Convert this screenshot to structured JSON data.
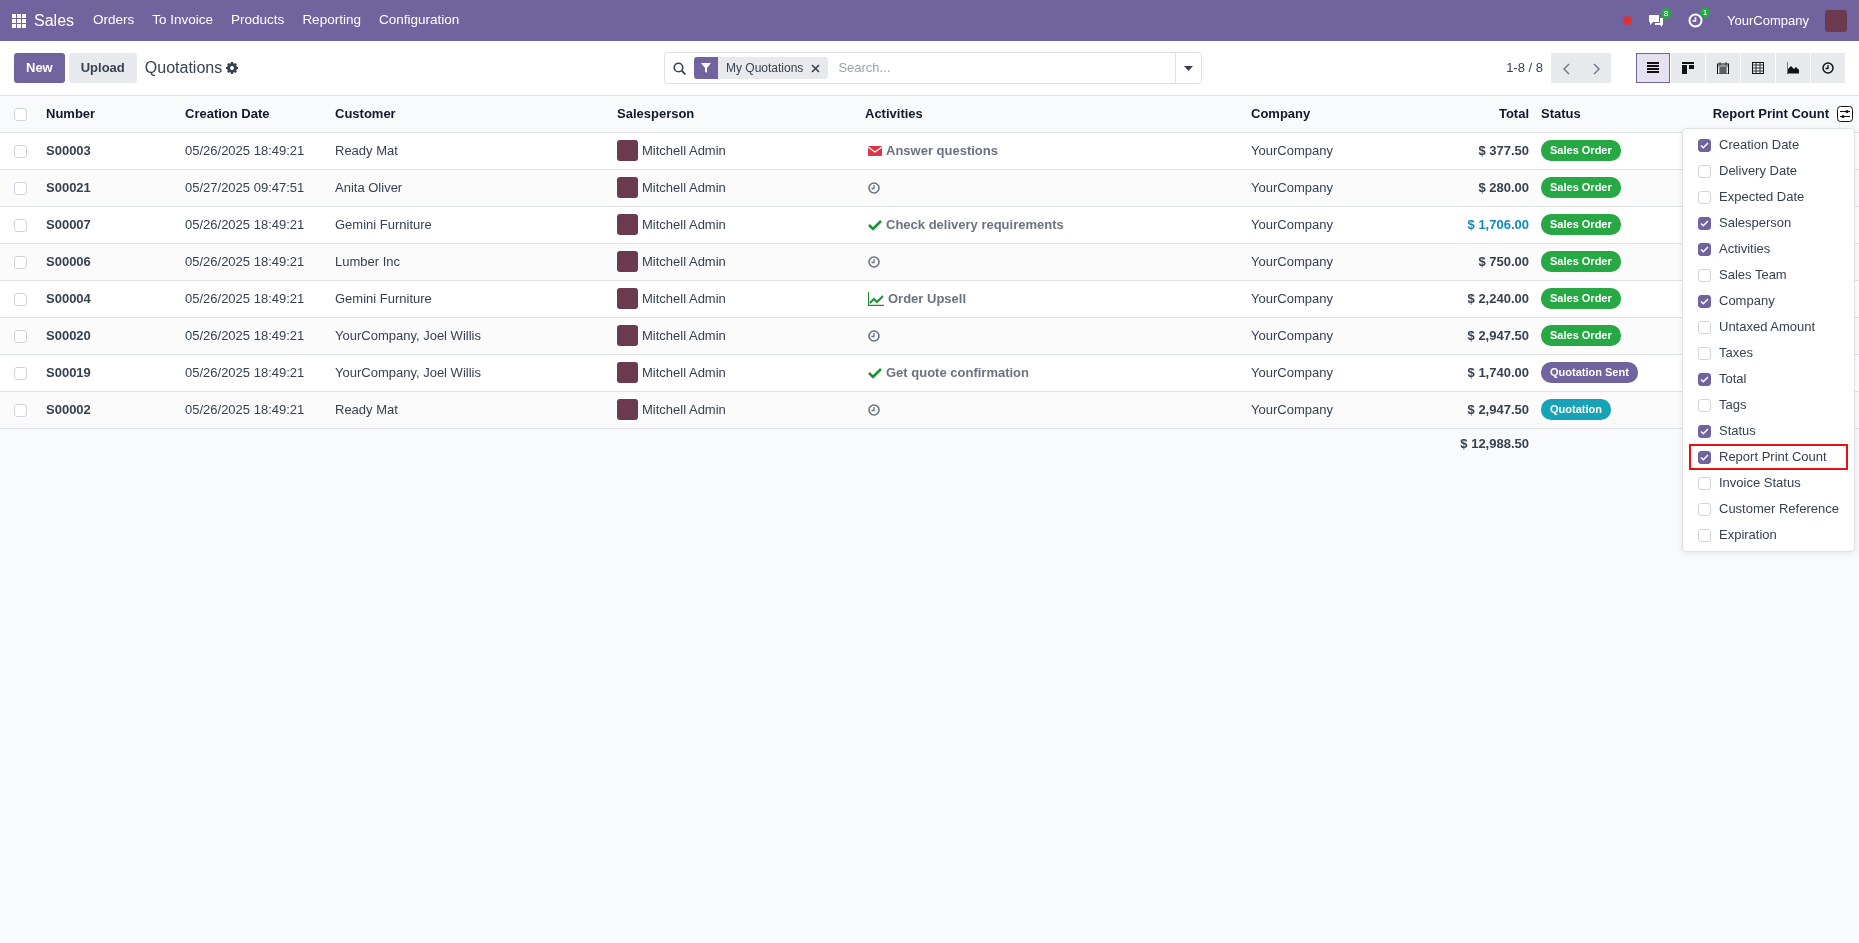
{
  "navbar": {
    "app": "Sales",
    "menu": [
      "Orders",
      "To Invoice",
      "Products",
      "Reporting",
      "Configuration"
    ],
    "messages_count": "8",
    "activities_count": "1",
    "company": "YourCompany"
  },
  "control_panel": {
    "buttons": [
      {
        "label": "New",
        "kind": "primary"
      },
      {
        "label": "Upload",
        "kind": "secondary"
      }
    ],
    "breadcrumb": "Quotations",
    "filter_facet": "My Quotations",
    "search_placeholder": "Search...",
    "pager": "1-8 / 8",
    "views": [
      {
        "kind": "list",
        "selected": true
      },
      {
        "kind": "kanban",
        "selected": false
      },
      {
        "kind": "calendar",
        "selected": false
      },
      {
        "kind": "pivot",
        "selected": false
      },
      {
        "kind": "graph",
        "selected": false
      },
      {
        "kind": "activity",
        "selected": false
      }
    ]
  },
  "table": {
    "all_selected": false,
    "columns": [
      "Number",
      "Creation Date",
      "Customer",
      "Salesperson",
      "Activities",
      "Company",
      "Total",
      "Status",
      "Report Print Count"
    ],
    "rows": [
      {
        "selected": false,
        "number": "S00003",
        "creation_date": "05/26/2025 18:49:21",
        "customer": "Ready Mat",
        "salesperson": "Mitchell Admin",
        "activity": {
          "kind": "email",
          "label": "Answer questions"
        },
        "company": "YourCompany",
        "total": "$ 377.50",
        "total_highlighted": false,
        "status": {
          "label": "Sales Order",
          "color": "#28a745"
        }
      },
      {
        "selected": false,
        "number": "S00021",
        "creation_date": "05/27/2025 09:47:51",
        "customer": "Anita Oliver",
        "salesperson": "Mitchell Admin",
        "activity": {
          "kind": "clock"
        },
        "company": "YourCompany",
        "total": "$ 280.00",
        "total_highlighted": false,
        "status": {
          "label": "Sales Order",
          "color": "#28a745"
        }
      },
      {
        "selected": false,
        "number": "S00007",
        "creation_date": "05/26/2025 18:49:21",
        "customer": "Gemini Furniture",
        "salesperson": "Mitchell Admin",
        "activity": {
          "kind": "check",
          "label": "Check delivery requirements"
        },
        "company": "YourCompany",
        "total": "$ 1,706.00",
        "total_highlighted": true,
        "status": {
          "label": "Sales Order",
          "color": "#28a745"
        }
      },
      {
        "selected": false,
        "number": "S00006",
        "creation_date": "05/26/2025 18:49:21",
        "customer": "Lumber Inc",
        "salesperson": "Mitchell Admin",
        "activity": {
          "kind": "clock"
        },
        "company": "YourCompany",
        "total": "$ 750.00",
        "total_highlighted": false,
        "status": {
          "label": "Sales Order",
          "color": "#28a745"
        }
      },
      {
        "selected": false,
        "number": "S00004",
        "creation_date": "05/26/2025 18:49:21",
        "customer": "Gemini Furniture",
        "salesperson": "Mitchell Admin",
        "activity": {
          "kind": "upsell",
          "label": "Order Upsell"
        },
        "company": "YourCompany",
        "total": "$ 2,240.00",
        "total_highlighted": false,
        "status": {
          "label": "Sales Order",
          "color": "#28a745"
        }
      },
      {
        "selected": false,
        "number": "S00020",
        "creation_date": "05/26/2025 18:49:21",
        "customer": "YourCompany, Joel Willis",
        "salesperson": "Mitchell Admin",
        "activity": {
          "kind": "clock"
        },
        "company": "YourCompany",
        "total": "$ 2,947.50",
        "total_highlighted": false,
        "status": {
          "label": "Sales Order",
          "color": "#28a745"
        }
      },
      {
        "selected": false,
        "number": "S00019",
        "creation_date": "05/26/2025 18:49:21",
        "customer": "YourCompany, Joel Willis",
        "salesperson": "Mitchell Admin",
        "activity": {
          "kind": "check",
          "label": "Get quote confirmation"
        },
        "company": "YourCompany",
        "total": "$ 1,740.00",
        "total_highlighted": false,
        "status": {
          "label": "Quotation Sent",
          "color": "#71639e"
        }
      },
      {
        "selected": false,
        "number": "S00002",
        "creation_date": "05/26/2025 18:49:21",
        "customer": "Ready Mat",
        "salesperson": "Mitchell Admin",
        "activity": {
          "kind": "clock"
        },
        "company": "YourCompany",
        "total": "$ 2,947.50",
        "total_highlighted": false,
        "status": {
          "label": "Quotation",
          "color": "#17a2b8"
        }
      }
    ],
    "footer_total": "$ 12,988.50"
  },
  "column_menu": {
    "items": [
      {
        "label": "Creation Date",
        "checked": true,
        "highlighted": false
      },
      {
        "label": "Delivery Date",
        "checked": false,
        "highlighted": false
      },
      {
        "label": "Expected Date",
        "checked": false,
        "highlighted": false
      },
      {
        "label": "Salesperson",
        "checked": true,
        "highlighted": false
      },
      {
        "label": "Activities",
        "checked": true,
        "highlighted": false
      },
      {
        "label": "Sales Team",
        "checked": false,
        "highlighted": false
      },
      {
        "label": "Company",
        "checked": true,
        "highlighted": false
      },
      {
        "label": "Untaxed Amount",
        "checked": false,
        "highlighted": false
      },
      {
        "label": "Taxes",
        "checked": false,
        "highlighted": false
      },
      {
        "label": "Total",
        "checked": true,
        "highlighted": false
      },
      {
        "label": "Tags",
        "checked": false,
        "highlighted": false
      },
      {
        "label": "Status",
        "checked": true,
        "highlighted": false
      },
      {
        "label": "Report Print Count",
        "checked": true,
        "highlighted": true
      },
      {
        "label": "Invoice Status",
        "checked": false,
        "highlighted": false
      },
      {
        "label": "Customer Reference",
        "checked": false,
        "highlighted": false
      },
      {
        "label": "Expiration",
        "checked": false,
        "highlighted": false
      }
    ]
  }
}
